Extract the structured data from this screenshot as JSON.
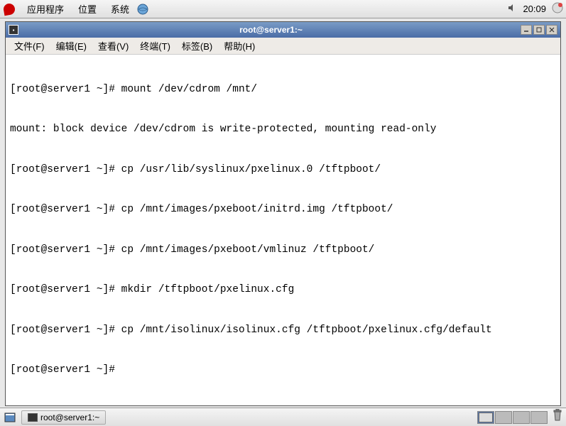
{
  "top_panel": {
    "menu": {
      "applications": "应用程序",
      "places": "位置",
      "system": "系统"
    },
    "clock": "20:09"
  },
  "window": {
    "title": "root@server1:~",
    "menubar": {
      "file": "文件(F)",
      "edit": "编辑(E)",
      "view": "查看(V)",
      "terminal": "终端(T)",
      "tabs": "标签(B)",
      "help": "帮助(H)"
    }
  },
  "terminal": {
    "lines": [
      "[root@server1 ~]# mount /dev/cdrom /mnt/",
      "mount: block device /dev/cdrom is write-protected, mounting read-only",
      "[root@server1 ~]# cp /usr/lib/syslinux/pxelinux.0 /tftpboot/",
      "[root@server1 ~]# cp /mnt/images/pxeboot/initrd.img /tftpboot/",
      "[root@server1 ~]# cp /mnt/images/pxeboot/vmlinuz /tftpboot/",
      "[root@server1 ~]# mkdir /tftpboot/pxelinux.cfg",
      "[root@server1 ~]# cp /mnt/isolinux/isolinux.cfg /tftpboot/pxelinux.cfg/default",
      "[root@server1 ~]# "
    ]
  },
  "bottom_panel": {
    "task": "root@server1:~"
  }
}
